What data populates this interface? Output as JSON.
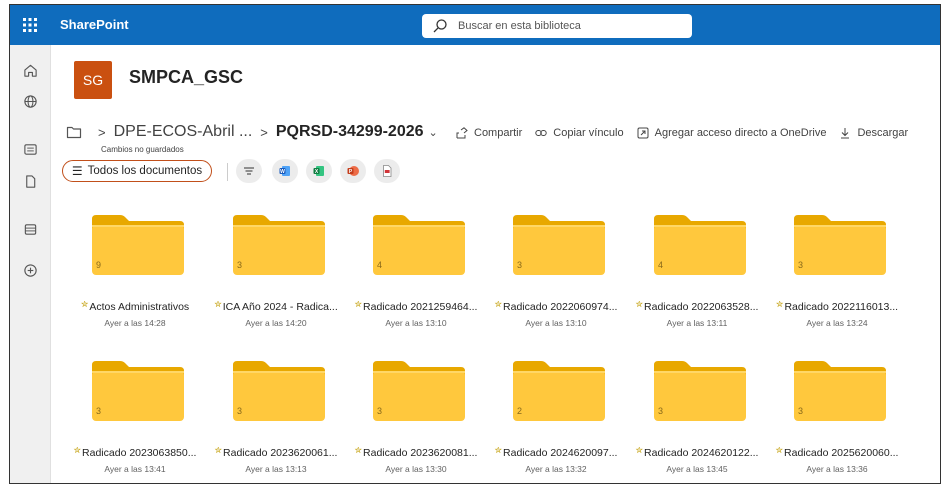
{
  "topbar": {
    "brand": "SharePoint",
    "search_placeholder": "Buscar en esta biblioteca"
  },
  "site": {
    "logo_text": "SG",
    "title": "SMPCA_GSC"
  },
  "breadcrumb": {
    "parent": "DPE-ECOS-Abril ...",
    "current": "PQRSD-34299-2026"
  },
  "actions": [
    {
      "label": "Compartir",
      "icon": "share-icon"
    },
    {
      "label": "Copiar vínculo",
      "icon": "link-icon"
    },
    {
      "label": "Agregar acceso directo a OneDrive",
      "icon": "shortcut-icon"
    },
    {
      "label": "Descargar",
      "icon": "download-icon"
    }
  ],
  "view": {
    "unsaved": "Cambios no guardados",
    "label": "Todos los documentos"
  },
  "colors": {
    "topbar": "#0f6cbd",
    "site_logo": "#ca5010",
    "view_border": "#c14f1a",
    "folder": "#ffc83d"
  },
  "folders": [
    {
      "name": "Actos Administrativos",
      "date": "Ayer a las 14:28",
      "count": "9"
    },
    {
      "name": "ICA Año 2024 - Radica...",
      "date": "Ayer a las 14:20",
      "count": "3"
    },
    {
      "name": "Radicado 2021259464...",
      "date": "Ayer a las 13:10",
      "count": "4"
    },
    {
      "name": "Radicado 2022060974...",
      "date": "Ayer a las 13:10",
      "count": "3"
    },
    {
      "name": "Radicado 2022063528...",
      "date": "Ayer a las 13:11",
      "count": "4"
    },
    {
      "name": "Radicado 2022116013...",
      "date": "Ayer a las 13:24",
      "count": "3"
    },
    {
      "name": "Radicado 2023063850...",
      "date": "Ayer a las 13:41",
      "count": "3"
    },
    {
      "name": "Radicado 2023620061...",
      "date": "Ayer a las 13:13",
      "count": "3"
    },
    {
      "name": "Radicado 2023620081...",
      "date": "Ayer a las 13:30",
      "count": "3"
    },
    {
      "name": "Radicado 2024620097...",
      "date": "Ayer a las 13:32",
      "count": "2"
    },
    {
      "name": "Radicado 2024620122...",
      "date": "Ayer a las 13:45",
      "count": "3"
    },
    {
      "name": "Radicado 2025620060...",
      "date": "Ayer a las 13:36",
      "count": "3"
    }
  ]
}
